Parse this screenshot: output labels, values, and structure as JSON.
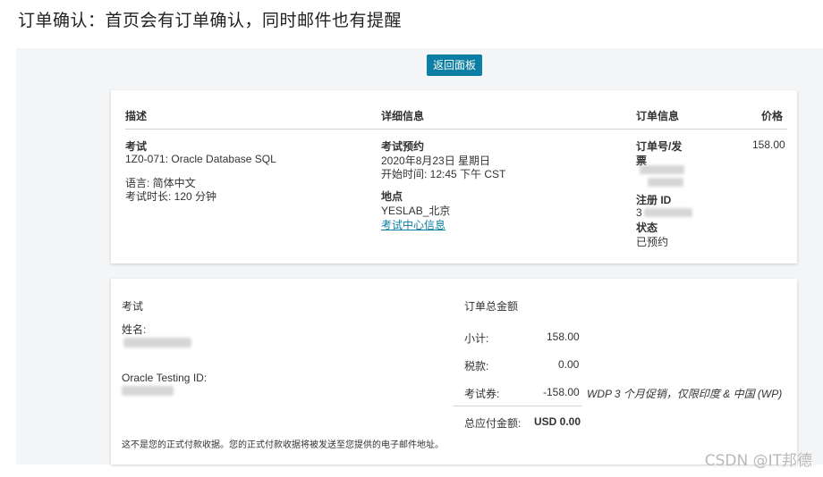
{
  "caption": "订单确认：首页会有订单确认，同时邮件也有提醒",
  "back_button": "返回面板",
  "order_card": {
    "headers": {
      "description": "描述",
      "details": "详细信息",
      "order_info": "订单信息",
      "price": "价格"
    },
    "exam": {
      "label": "考试",
      "name": "1Z0-071: Oracle Database SQL",
      "language": "语言: 简体中文",
      "duration": "考试时长: 120 分钟"
    },
    "appointment": {
      "label": "考试预约",
      "date": "2020年8月23日 星期日",
      "start_time": "开始时间: 12:45 下午 CST",
      "location_label": "地点",
      "location": "YESLAB_北京",
      "center_link": "考试中心信息"
    },
    "order": {
      "order_invoice_label_line1": "订单号/发",
      "order_invoice_label_line2": "票",
      "registration_label": "注册 ID",
      "registration_partial": "3",
      "status_label": "状态",
      "status_value": "已预约"
    },
    "price": "158.00"
  },
  "summary_card": {
    "exam_label": "考试",
    "name_label": "姓名:",
    "testing_id_label": "Oracle Testing ID:",
    "disclaimer": "这不是您的正式付款收据。您的正式付款收据将被发送至您提供的电子邮件地址。",
    "totals": {
      "title": "订单总金额",
      "subtotal_label": "小计:",
      "subtotal_value": "158.00",
      "tax_label": "税款:",
      "tax_value": "0.00",
      "voucher_label": "考试券:",
      "voucher_value": "-158.00",
      "voucher_note": "WDP 3 个月促销，仅限印度 & 中国 (WP)",
      "due_label": "总应付金额:",
      "due_value": "USD 0.00"
    }
  },
  "watermark": "CSDN @IT邦德",
  "colors": {
    "accent": "#0b7ea3",
    "page_bg": "#f4f5f6",
    "card_bg": "#ffffff"
  }
}
